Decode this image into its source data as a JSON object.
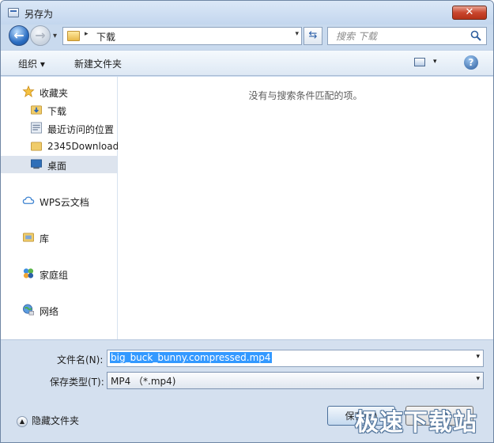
{
  "window": {
    "title": "另存为",
    "close_label": "✕"
  },
  "navigation": {
    "back_glyph": "←",
    "forward_glyph": "→",
    "address": {
      "separator": "▸",
      "path_label": "下载",
      "dropdown": "▾"
    },
    "refresh_glyph": "⇆",
    "search": {
      "placeholder": "搜索 下载"
    }
  },
  "toolbar": {
    "organize_label": "组织 ▾",
    "new_folder_label": "新建文件夹",
    "view_arrow": "▾",
    "help_label": "?"
  },
  "sidebar": {
    "items": [
      {
        "label": "收藏夹",
        "icon": "star-icon"
      },
      {
        "label": "下载",
        "icon": "download-folder-icon"
      },
      {
        "label": "最近访问的位置",
        "icon": "recent-places-icon"
      },
      {
        "label": "2345Download",
        "icon": "folder-icon"
      },
      {
        "label": "桌面",
        "icon": "desktop-icon"
      },
      {
        "label": "WPS云文档",
        "icon": "cloud-icon"
      },
      {
        "label": "库",
        "icon": "library-icon"
      },
      {
        "label": "家庭组",
        "icon": "homegroup-icon"
      },
      {
        "label": "网络",
        "icon": "network-icon"
      }
    ]
  },
  "content": {
    "empty_message": "没有与搜索条件匹配的项。"
  },
  "form": {
    "filename_label": "文件名(N):",
    "filename_value": "big_buck_bunny.compressed.mp4",
    "filetype_label": "保存类型(T):",
    "filetype_value": "MP4 （*.mp4)",
    "dropdown_glyph": "▾"
  },
  "footer": {
    "hide_folders_label": "隐藏文件夹",
    "hide_folders_glyph": "▲",
    "save_label": "保存(S)",
    "cancel_label": "取消"
  },
  "watermark": "极速下载站",
  "colors": {
    "selection": "#3399ff",
    "title_bar": "#c3d6ee",
    "panel": "#d4e0ef"
  }
}
